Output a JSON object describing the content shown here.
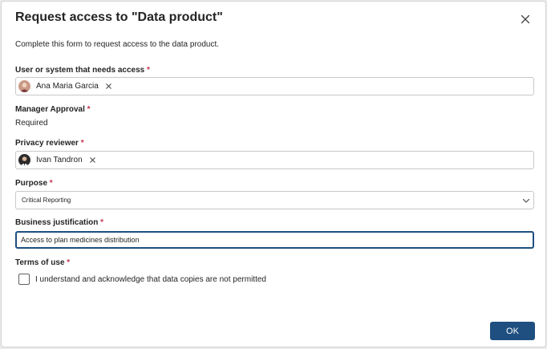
{
  "dialog": {
    "title": "Request access to \"Data product\"",
    "description": "Complete this form to request access to the data product."
  },
  "user_field": {
    "label": "User or system that needs access",
    "required_mark": "*",
    "chip_name": "Ana Maria Garcia"
  },
  "manager_approval": {
    "label": "Manager Approval",
    "required_mark": "*",
    "value": "Required"
  },
  "privacy_reviewer": {
    "label": "Privacy reviewer",
    "required_mark": "*",
    "chip_name": "Ivan Tandron"
  },
  "purpose": {
    "label": "Purpose",
    "required_mark": "*",
    "selected": "Critical Reporting"
  },
  "business_justification": {
    "label": "Business justification",
    "required_mark": "*",
    "value": "Access to plan medicines distribution"
  },
  "terms": {
    "label": "Terms of use",
    "required_mark": "*",
    "checkbox_label": "I understand and acknowledge that data copies are not permitted",
    "checked": false
  },
  "footer": {
    "ok_label": "OK"
  },
  "colors": {
    "primary": "#1e4f80",
    "required": "#c4314b"
  },
  "icons": {
    "close": "close-icon",
    "chip_remove": "dismiss-icon",
    "dropdown": "chevron-down-icon"
  }
}
